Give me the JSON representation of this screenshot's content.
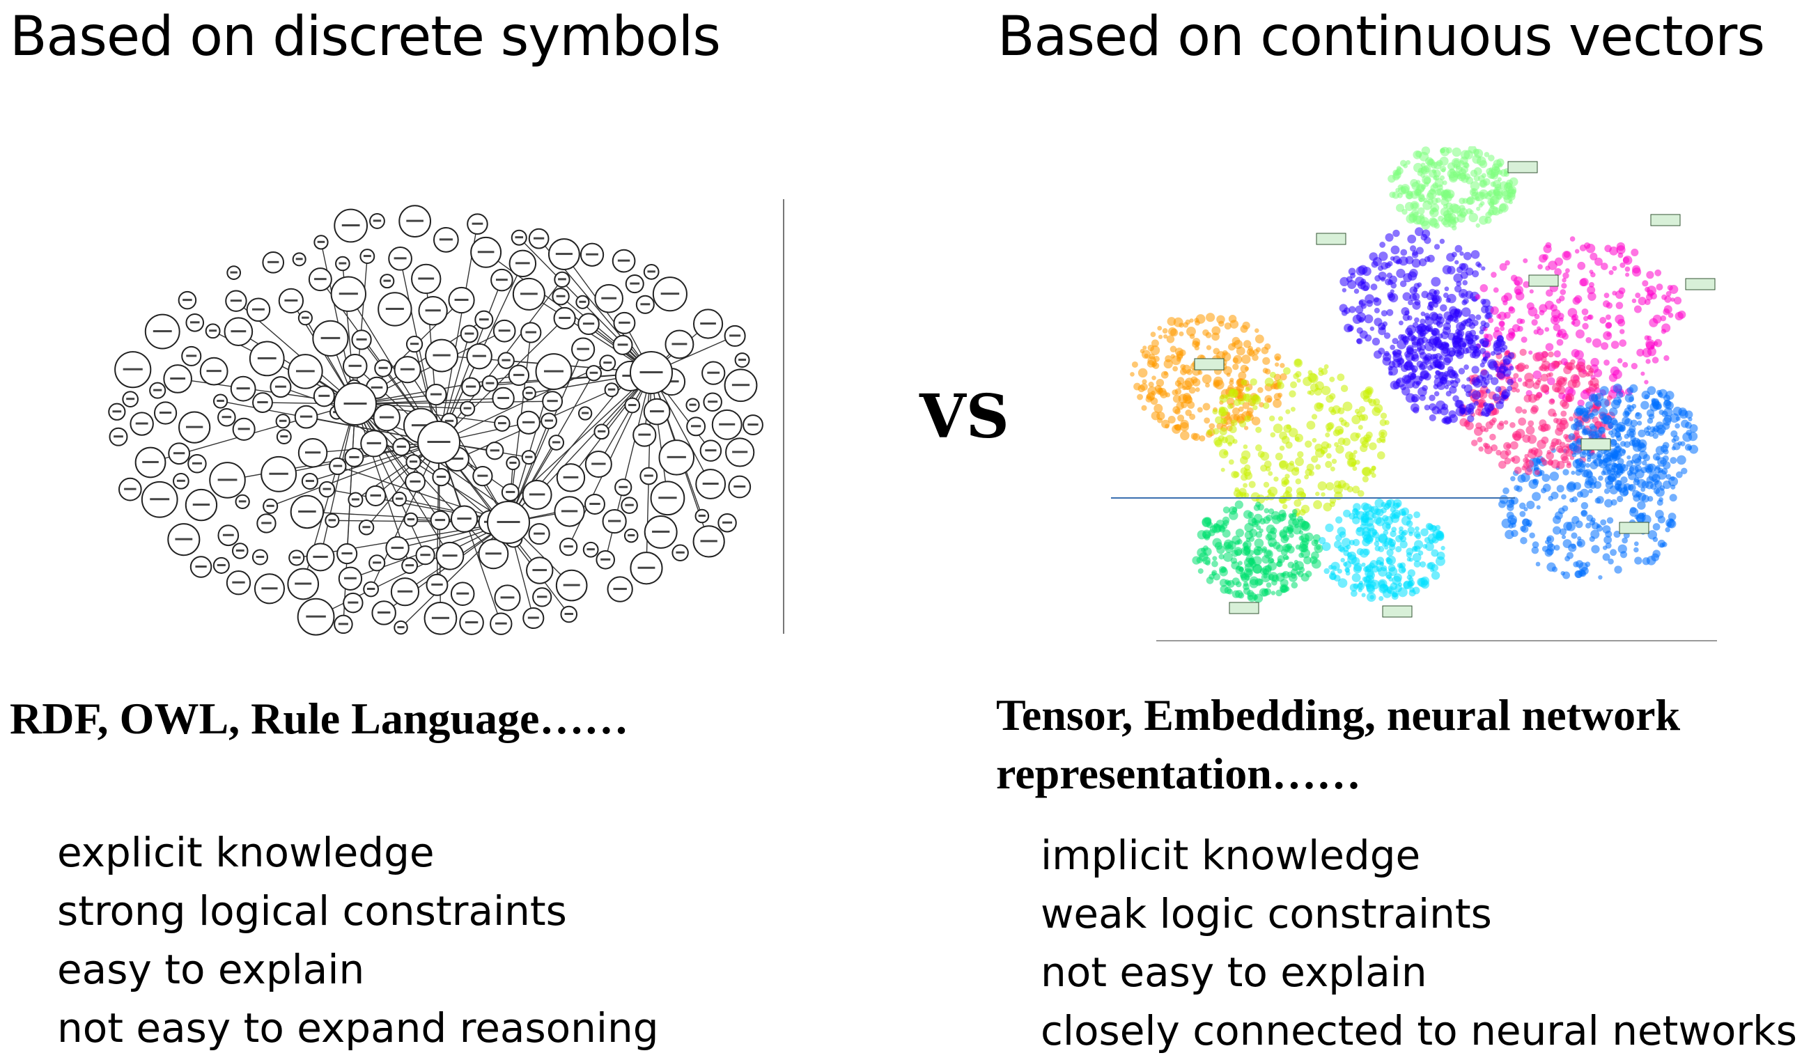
{
  "left": {
    "heading": "Based on discrete symbols",
    "technologies": "RDF, OWL, Rule Language……",
    "properties": [
      "explicit knowledge",
      "strong logical constraints",
      "easy to explain",
      "not easy to expand reasoning"
    ]
  },
  "right": {
    "heading": "Based on continuous vectors",
    "technologies": "Tensor, Embedding, neural network representation……",
    "properties": [
      "implicit knowledge",
      "weak logic constraints",
      "not easy to explain",
      "closely connected to neural networks"
    ]
  },
  "separator": "VS",
  "graph_figure": {
    "description_icon": "knowledge-graph-image",
    "node_stroke": "#222222",
    "node_fill": "#ffffff"
  },
  "embedding_figure": {
    "description_icon": "embedding-cluster-image",
    "cluster_colors": [
      "#ff9a00",
      "#c8f000",
      "#00e070",
      "#00e0ff",
      "#0070ff",
      "#2a00ff",
      "#ff00cc",
      "#ff2080",
      "#80ff80"
    ]
  }
}
